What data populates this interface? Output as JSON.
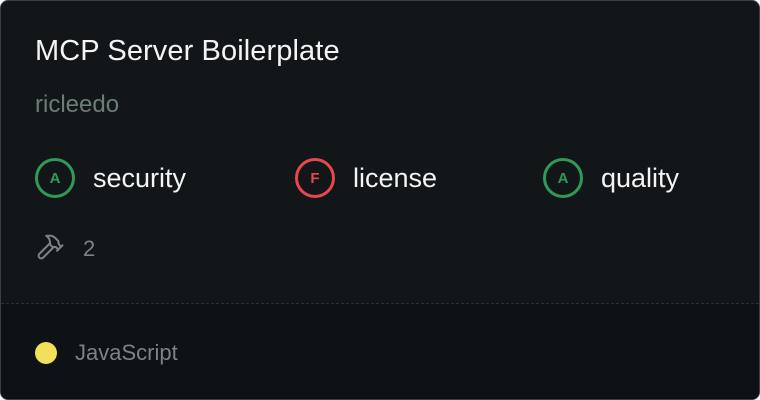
{
  "card": {
    "title": "MCP Server Boilerplate",
    "owner": "ricleedo"
  },
  "scores": [
    {
      "grade": "A",
      "label": "security",
      "status": "pass",
      "color": "#2f9a57"
    },
    {
      "grade": "F",
      "label": "license",
      "status": "fail",
      "color": "#e5484d"
    },
    {
      "grade": "A",
      "label": "quality",
      "status": "pass",
      "color": "#2f9a57"
    }
  ],
  "tools": {
    "icon": "hammer-icon",
    "count": "2"
  },
  "footer": {
    "language": "JavaScript",
    "language_color": "#f1e05a"
  }
}
